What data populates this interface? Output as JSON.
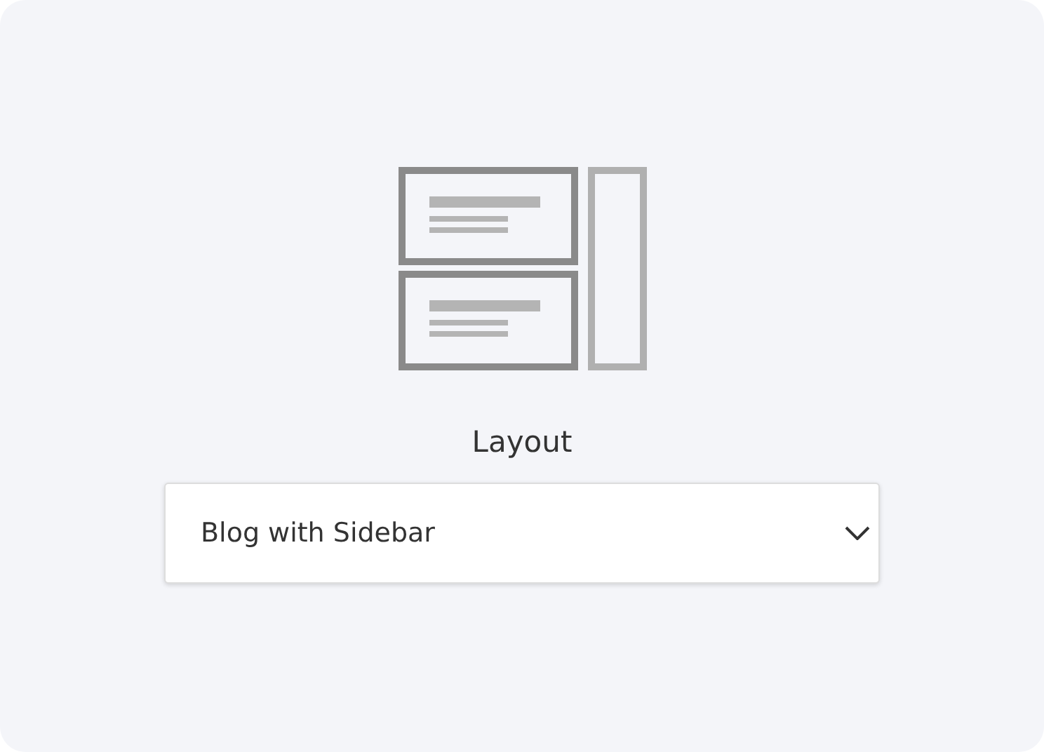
{
  "layout_field": {
    "label": "Layout",
    "value": "Blog with Sidebar"
  }
}
